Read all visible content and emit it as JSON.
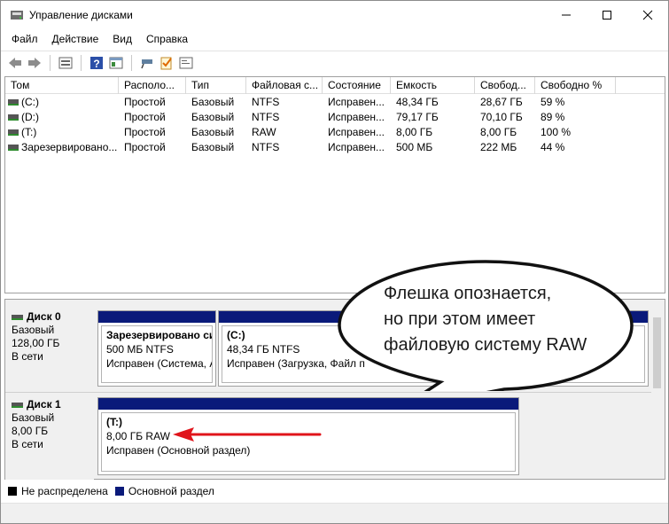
{
  "window": {
    "title": "Управление дисками",
    "controls": [
      "minimize-icon",
      "maximize-icon",
      "close-icon"
    ]
  },
  "menu": [
    "Файл",
    "Действие",
    "Вид",
    "Справка"
  ],
  "toolbar": {
    "icons": [
      "back-arrow-icon",
      "forward-arrow-icon",
      "volume-list-icon",
      "help-icon",
      "properties-icon",
      "connect-icon",
      "check-icon",
      "console-icon"
    ]
  },
  "volume_list": {
    "columns": [
      "Том",
      "Располо...",
      "Тип",
      "Файловая с...",
      "Состояние",
      "Емкость",
      "Свобод...",
      "Свободно %"
    ],
    "rows": [
      [
        "(C:)",
        "Простой",
        "Базовый",
        "NTFS",
        "Исправен...",
        "48,34 ГБ",
        "28,67 ГБ",
        "59 %"
      ],
      [
        "(D:)",
        "Простой",
        "Базовый",
        "NTFS",
        "Исправен...",
        "79,17 ГБ",
        "70,10 ГБ",
        "89 %"
      ],
      [
        "(T:)",
        "Простой",
        "Базовый",
        "RAW",
        "Исправен...",
        "8,00 ГБ",
        "8,00 ГБ",
        "100 %"
      ],
      [
        "Зарезервировано...",
        "Простой",
        "Базовый",
        "NTFS",
        "Исправен...",
        "500 МБ",
        "222 МБ",
        "44 %"
      ]
    ]
  },
  "disks": [
    {
      "name": "Диск 0",
      "type": "Базовый",
      "size": "128,00 ГБ",
      "status": "В сети",
      "partitions": [
        {
          "name": "Зарезервировано си",
          "size": "500 МБ NTFS",
          "status": "Исправен (Система, А"
        },
        {
          "name": "(C:)",
          "size": "48,34 ГБ NTFS",
          "status": "Исправен (Загрузка, Файл п"
        }
      ]
    },
    {
      "name": "Диск 1",
      "type": "Базовый",
      "size": "8,00 ГБ",
      "status": "В сети",
      "partitions": [
        {
          "name": "(T:)",
          "size": "8,00 ГБ RAW",
          "status": "Исправен (Основной раздел)"
        }
      ]
    }
  ],
  "callout": {
    "line1": "Флешка опознается,",
    "line2": "но при этом имеет",
    "line3": "файловую систему RAW"
  },
  "legend": [
    {
      "label": "Не распределена",
      "color": "#000000"
    },
    {
      "label": "Основной раздел",
      "color": "#0a1a7a"
    }
  ],
  "colors": {
    "partition_bar": "#0a1a7a",
    "arrow": "#e0141b"
  }
}
